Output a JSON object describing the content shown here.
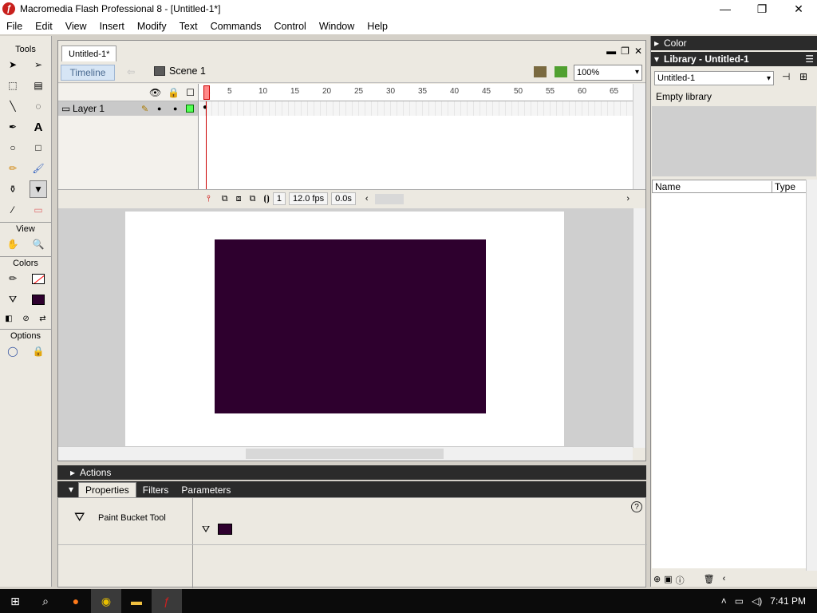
{
  "window": {
    "title": "Macromedia Flash Professional 8 - [Untitled-1*]",
    "logo_glyph": "ƒ"
  },
  "menubar": [
    "File",
    "Edit",
    "View",
    "Insert",
    "Modify",
    "Text",
    "Commands",
    "Control",
    "Window",
    "Help"
  ],
  "tools": {
    "title": "Tools",
    "view_label": "View",
    "colors_label": "Colors",
    "options_label": "Options",
    "stroke_color": "#ff0000",
    "fill_color": "#2e002e"
  },
  "document": {
    "tab_label": "Untitled-1*",
    "timeline_button": "Timeline",
    "scene_label": "Scene 1",
    "zoom": "100%"
  },
  "timeline": {
    "layer_name": "Layer 1",
    "ruler_marks": [
      "1",
      "5",
      "10",
      "15",
      "20",
      "25",
      "30",
      "35",
      "40",
      "45",
      "50",
      "55",
      "60",
      "65"
    ],
    "current_frame": "1",
    "fps": "12.0 fps",
    "elapsed": "0.0s"
  },
  "stage": {
    "background": "#ffffff",
    "shape_color": "#2e002e"
  },
  "panels": {
    "actions_label": "Actions",
    "properties_tabs": [
      "Properties",
      "Filters",
      "Parameters"
    ],
    "tool_name": "Paint Bucket Tool",
    "help_glyph": "?"
  },
  "right_panel": {
    "color_label": "Color",
    "library_label": "Library - Untitled-1",
    "library_select": "Untitled-1",
    "empty_text": "Empty library",
    "col_name": "Name",
    "col_type": "Type"
  },
  "taskbar": {
    "clock": "7:41 PM"
  }
}
